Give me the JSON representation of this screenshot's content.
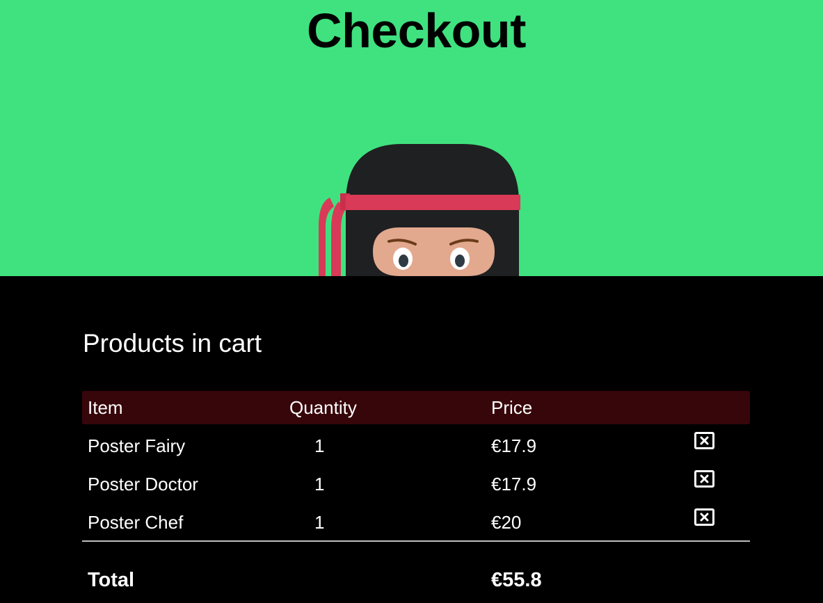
{
  "header": {
    "title": "Checkout",
    "background": "#3fe27f"
  },
  "cart": {
    "heading": "Products in cart",
    "columns": {
      "item": "Item",
      "quantity": "Quantity",
      "price": "Price"
    },
    "rows": [
      {
        "item": "Poster Fairy",
        "quantity": "1",
        "price": "€17.9"
      },
      {
        "item": "Poster Doctor",
        "quantity": "1",
        "price": "€17.9"
      },
      {
        "item": "Poster Chef",
        "quantity": "1",
        "price": "€20"
      }
    ],
    "remove_icon": "close-box-icon",
    "total_label": "Total",
    "total_value": "€55.8",
    "header_color": "#37060a"
  },
  "illustration": "ninja-mascot"
}
